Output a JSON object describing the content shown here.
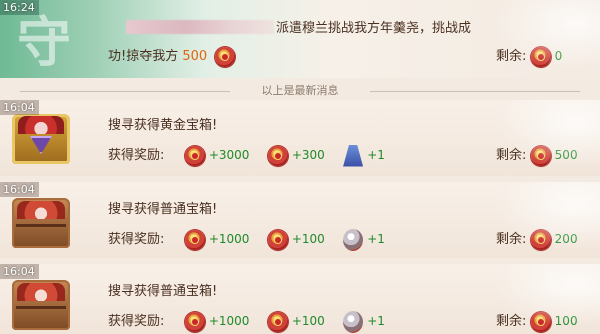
{
  "top_message": {
    "time": "16:24",
    "seal_char": "守",
    "text": "派遣穆兰挑战我方年羹尧，挑战成",
    "result_prefix": "功!掠夺我方",
    "result_amount": "500",
    "remain_label": "剩余:",
    "remain_value": "0"
  },
  "divider_text": "以上是最新消息",
  "messages": [
    {
      "time": "16:04",
      "chest": "gold",
      "title": "搜寻获得黄金宝箱!",
      "reward_label": "获得奖励:",
      "rewards": [
        {
          "icon": "coin-icon",
          "amount": "+3000"
        },
        {
          "icon": "coin-icon",
          "amount": "+300"
        },
        {
          "icon": "cape-icon",
          "amount": "+1"
        }
      ],
      "remain_label": "剩余:",
      "remain_value": "500"
    },
    {
      "time": "16:04",
      "chest": "normal",
      "title": "搜寻获得普通宝箱!",
      "reward_label": "获得奖励:",
      "rewards": [
        {
          "icon": "coin-icon",
          "amount": "+1000"
        },
        {
          "icon": "coin-icon",
          "amount": "+100"
        },
        {
          "icon": "orb-icon",
          "amount": "+1"
        }
      ],
      "remain_label": "剩余:",
      "remain_value": "200"
    },
    {
      "time": "16:04",
      "chest": "normal",
      "title": "搜寻获得普通宝箱!",
      "reward_label": "获得奖励:",
      "rewards": [
        {
          "icon": "coin-icon",
          "amount": "+1000"
        },
        {
          "icon": "coin-icon",
          "amount": "+100"
        },
        {
          "icon": "orb-icon",
          "amount": "+1"
        }
      ],
      "remain_label": "剩余:",
      "remain_value": "100"
    }
  ]
}
